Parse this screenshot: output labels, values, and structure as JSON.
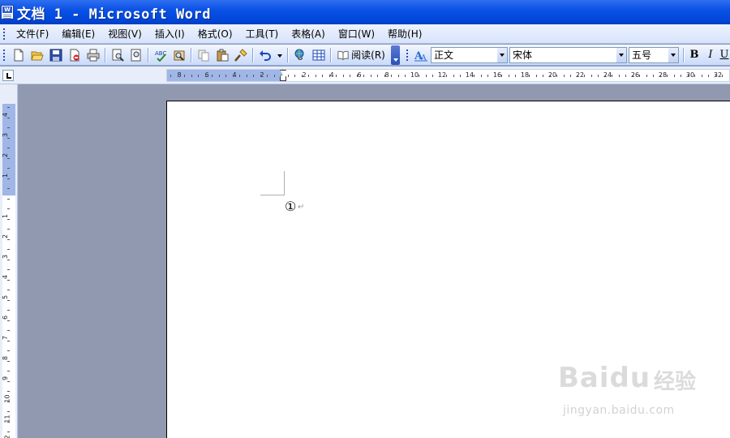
{
  "window": {
    "title": "文档 1 - Microsoft Word",
    "app_icon": "word-document-icon"
  },
  "menu": {
    "items": [
      "文件(F)",
      "编辑(E)",
      "视图(V)",
      "插入(I)",
      "格式(O)",
      "工具(T)",
      "表格(A)",
      "窗口(W)",
      "帮助(H)"
    ]
  },
  "toolbar": {
    "buttons": [
      "new-icon",
      "open-icon",
      "save-icon",
      "permission-icon",
      "print-icon",
      "print-preview-icon",
      "spelling-icon",
      "research-icon",
      "copy-icon",
      "paste-icon",
      "format-painter-icon",
      "undo-icon",
      "undo-dropdown-icon",
      "hyperlink-icon",
      "table-icon",
      "read-icon"
    ],
    "read_label": "阅读(R)",
    "style_value": "正文",
    "font_value": "宋体",
    "size_value": "五号",
    "bold_label": "B",
    "italic_label": "I",
    "underline_label": "U"
  },
  "ruler": {
    "horizontal_ticks": [
      "8",
      "6",
      "4",
      "2",
      "2",
      "4",
      "6",
      "8",
      "10",
      "12",
      "14",
      "16",
      "18",
      "20",
      "22",
      "24",
      "26",
      "28",
      "30",
      "32"
    ],
    "vertical_ticks": [
      "4",
      "3",
      "2",
      "1",
      "1",
      "2",
      "3",
      "4",
      "5",
      "6",
      "7",
      "8",
      "9",
      "10",
      "11",
      "12"
    ]
  },
  "document": {
    "text": "①",
    "paragraph_mark": "↵"
  },
  "watermark": {
    "brand": "Baidu",
    "cn": "经验",
    "url": "jingyan.baidu.com"
  }
}
